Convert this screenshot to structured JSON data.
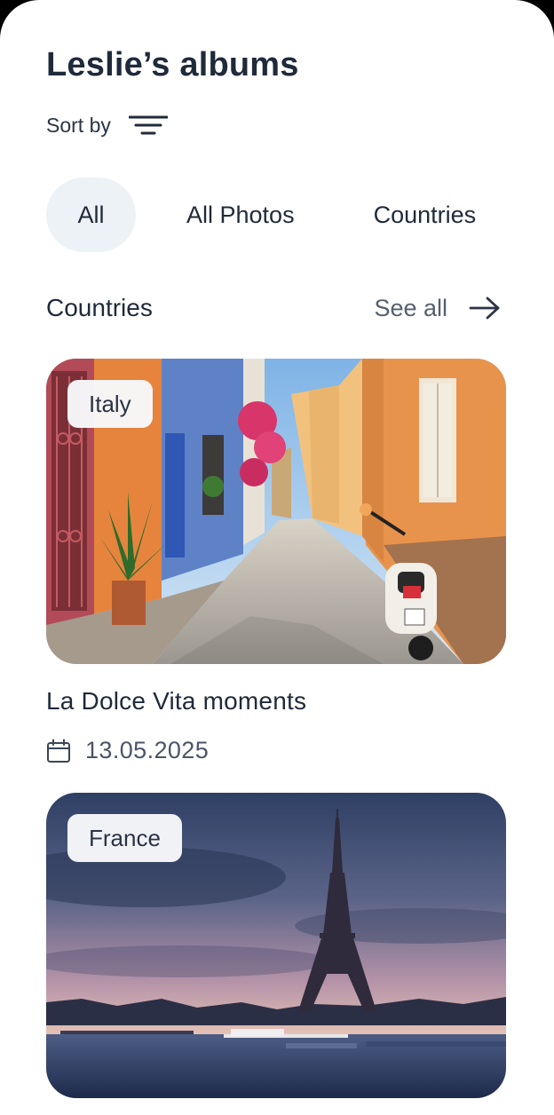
{
  "header": {
    "title": "Leslie’s albums",
    "sort_label": "Sort by"
  },
  "filters": [
    {
      "label": "All",
      "active": true
    },
    {
      "label": "All Photos",
      "active": false
    },
    {
      "label": "Countries",
      "active": false
    }
  ],
  "section": {
    "title": "Countries",
    "see_all": "See all"
  },
  "albums": [
    {
      "country": "Italy",
      "name": "La Dolce Vita moments",
      "date": "13.05.2025",
      "icon": "calendar-icon"
    },
    {
      "country": "France",
      "name": "",
      "date": ""
    }
  ],
  "colors": {
    "text": "#1f2a3a",
    "muted": "#556070",
    "chip_active_bg": "#edf2f7",
    "tag_bg": "#f7f8fa"
  }
}
